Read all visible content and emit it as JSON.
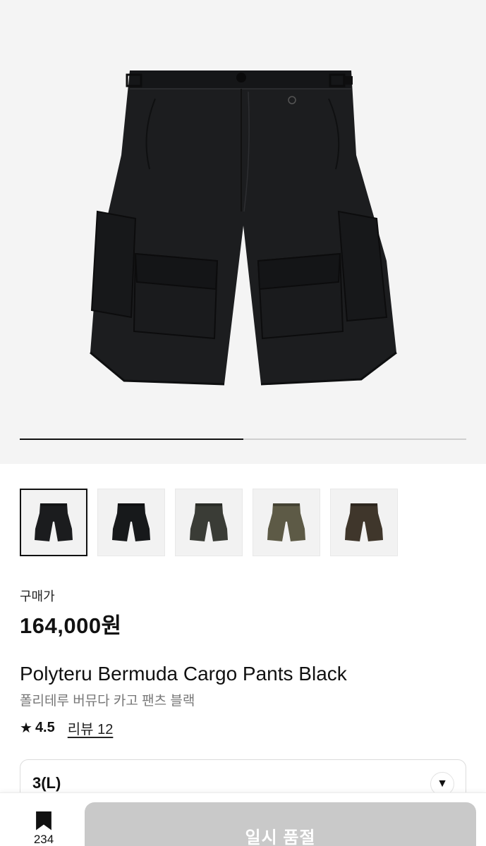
{
  "gallery": {
    "image_alt": "",
    "progress_fraction": 0.5,
    "thumbnails": [
      {
        "name": "black-1",
        "color": "#1b1c1e"
      },
      {
        "name": "black-2",
        "color": "#17191b"
      },
      {
        "name": "charcoal",
        "color": "#3a3c36"
      },
      {
        "name": "olive",
        "color": "#5d5a46"
      },
      {
        "name": "brown",
        "color": "#3f362b"
      }
    ]
  },
  "product": {
    "price_label": "구매가",
    "price": "164,000원",
    "title": "Polyteru Bermuda Cargo Pants Black",
    "subtitle": "폴리테루 버뮤다 카고 팬츠 블랙",
    "rating": "4.5",
    "review_label": "리뷰 12"
  },
  "option": {
    "selected": "3(L)"
  },
  "bottom_bar": {
    "bookmark_count": "234",
    "buy_button_label": "일시 품절"
  },
  "colors": {
    "accent": "#111111",
    "disabled_button": "#c9c9c9",
    "hero_bg": "#f4f4f4"
  }
}
